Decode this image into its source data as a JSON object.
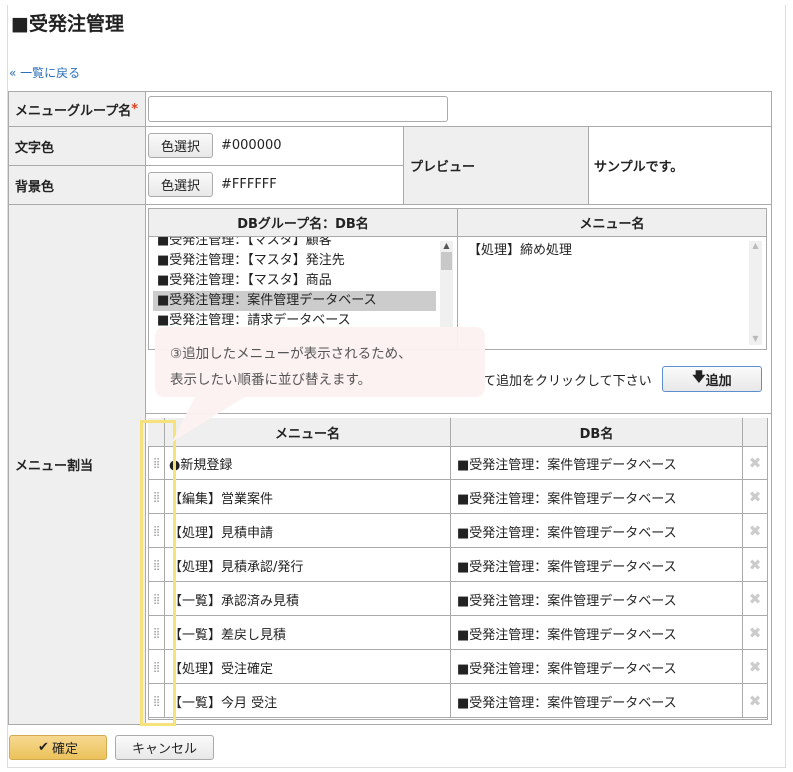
{
  "title": "■受発注管理",
  "back_link": "« 一覧に戻る",
  "form": {
    "group_name_label": "メニューグループ名",
    "required_mark": "*",
    "group_name_value": "",
    "text_color_label": "文字色",
    "bg_color_label": "背景色",
    "color_select_label": "色選択",
    "text_color_value": "#000000",
    "bg_color_value": "#FFFFFF",
    "preview_label": "プレビュー",
    "preview_sample": "サンプルです。",
    "menu_assign_label": "メニュー割当"
  },
  "picker": {
    "db_header": "DBグループ名：DB名",
    "menu_header": "メニュー名",
    "db_items": [
      "■受発注管理：【マスタ】顧客",
      "■受発注管理：【マスタ】発注先",
      "■受発注管理：【マスタ】商品",
      "■受発注管理：案件管理データベース",
      "■受発注管理：請求データベース"
    ],
    "menu_items": [
      "【処理】締め処理"
    ],
    "instruction": "て追加をクリックして下さい",
    "add_label": "追加"
  },
  "assigned": {
    "menu_header": "メニュー名",
    "db_header": "DB名",
    "rows": [
      {
        "menu": "●新規登録",
        "db": "■受発注管理：案件管理データベース"
      },
      {
        "menu": "【編集】営業案件",
        "db": "■受発注管理：案件管理データベース"
      },
      {
        "menu": "【処理】見積申請",
        "db": "■受発注管理：案件管理データベース"
      },
      {
        "menu": "【処理】見積承認/発行",
        "db": "■受発注管理：案件管理データベース"
      },
      {
        "menu": "【一覧】承認済み見積",
        "db": "■受発注管理：案件管理データベース"
      },
      {
        "menu": "【一覧】差戻し見積",
        "db": "■受発注管理：案件管理データベース"
      },
      {
        "menu": "【処理】受注確定",
        "db": "■受発注管理：案件管理データベース"
      },
      {
        "menu": "【一覧】今月 受注",
        "db": "■受発注管理：案件管理データベース"
      }
    ]
  },
  "callout": {
    "line1": "③追加したメニューが表示されるため、",
    "line2": "表示したい順番に並び替えます。"
  },
  "footer": {
    "confirm_label": "確定",
    "cancel_label": "キャンセル"
  },
  "colors": {
    "accent_yellow": "#f5e27a",
    "confirm_bg": "#f0c860",
    "link": "#2a6ebb"
  }
}
